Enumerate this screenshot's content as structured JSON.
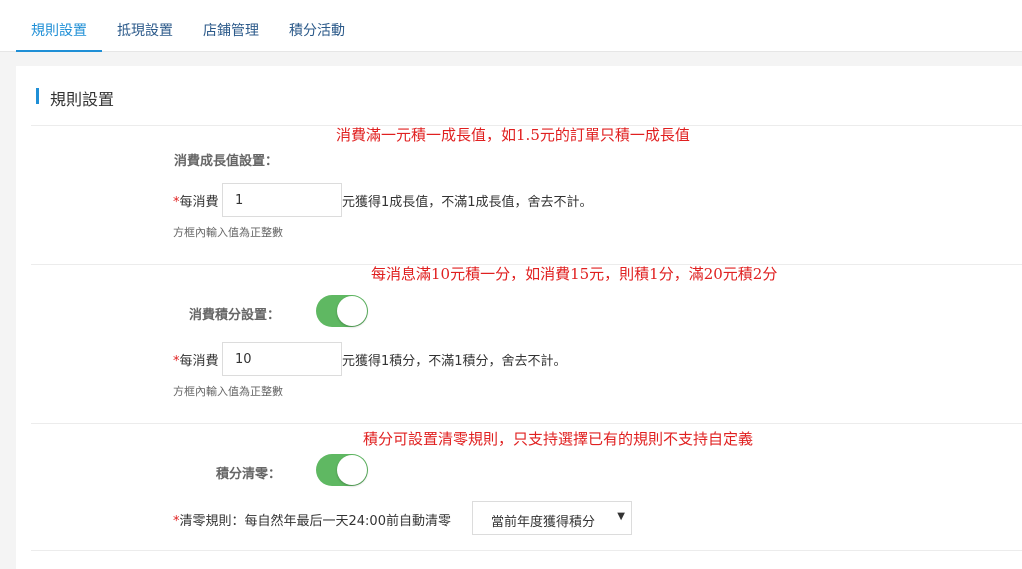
{
  "tabs": [
    {
      "label": "規則設置",
      "active": true
    },
    {
      "label": "抵現設置",
      "active": false
    },
    {
      "label": "店鋪管理",
      "active": false
    },
    {
      "label": "積分活動",
      "active": false
    }
  ],
  "section_title": "規則設置",
  "growth": {
    "note": "消費滿一元積一成長值，如1.5元的訂單只積一成長值",
    "label": "消費成長值設置：",
    "required_mark": "*",
    "field_label": "每消費",
    "value": "1",
    "suffix": "元獲得1成長值，不滿1成長值，舍去不計。",
    "hint": "方框內輸入值為正整數"
  },
  "points": {
    "note": "每消息滿10元積一分，如消費15元，則積1分，滿20元積2分",
    "label": "消費積分設置：",
    "toggle_on": true,
    "required_mark": "*",
    "field_label": "每消費",
    "value": "10",
    "suffix": "元獲得1積分，不滿1積分，舍去不計。",
    "hint": "方框內輸入值為正整數"
  },
  "clear": {
    "note": "積分可設置清零規則，只支持選擇已有的規則不支持自定義",
    "label": "積分清零：",
    "toggle_on": true,
    "required_mark": "*",
    "rule_text": "清零規則：每自然年最后一天24:00前自動清零",
    "select_value": "當前年度獲得積分",
    "caret": "▼"
  },
  "colors": {
    "accent": "#1f8fd6",
    "note_red": "#e02020",
    "toggle_green": "#5fb862"
  }
}
